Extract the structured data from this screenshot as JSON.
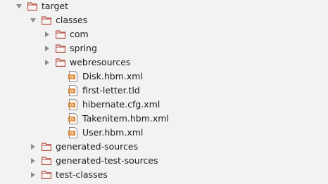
{
  "tree": {
    "target": {
      "label": "target",
      "icon": "folder-icon",
      "state": "expanded"
    },
    "classes": {
      "label": "classes",
      "icon": "folder-icon",
      "state": "expanded"
    },
    "com": {
      "label": "com",
      "icon": "folder-icon",
      "state": "collapsed"
    },
    "spring": {
      "label": "spring",
      "icon": "folder-icon",
      "state": "collapsed"
    },
    "webresources": {
      "label": "webresources",
      "icon": "folder-icon",
      "state": "collapsed"
    },
    "disk": {
      "label": "Disk.hbm.xml",
      "icon": "xml-file-icon"
    },
    "first_letter": {
      "label": "first-letter.tld",
      "icon": "xml-file-icon"
    },
    "hibernate_cfg": {
      "label": "hibernate.cfg.xml",
      "icon": "xml-file-icon"
    },
    "takenitem": {
      "label": "Takenitem.hbm.xml",
      "icon": "xml-file-icon"
    },
    "user": {
      "label": "User.hbm.xml",
      "icon": "xml-file-icon"
    },
    "generated_sources": {
      "label": "generated-sources",
      "icon": "folder-icon",
      "state": "collapsed"
    },
    "generated_test_sources": {
      "label": "generated-test-sources",
      "icon": "folder-icon",
      "state": "collapsed"
    },
    "test_classes": {
      "label": "test-classes",
      "icon": "folder-icon",
      "state": "collapsed"
    }
  },
  "colors": {
    "folder_outline": "#b4493d",
    "folder_fill": "#f6f4f2",
    "arrow": "#8c8c8c",
    "xml_badge": "#d9822b"
  }
}
